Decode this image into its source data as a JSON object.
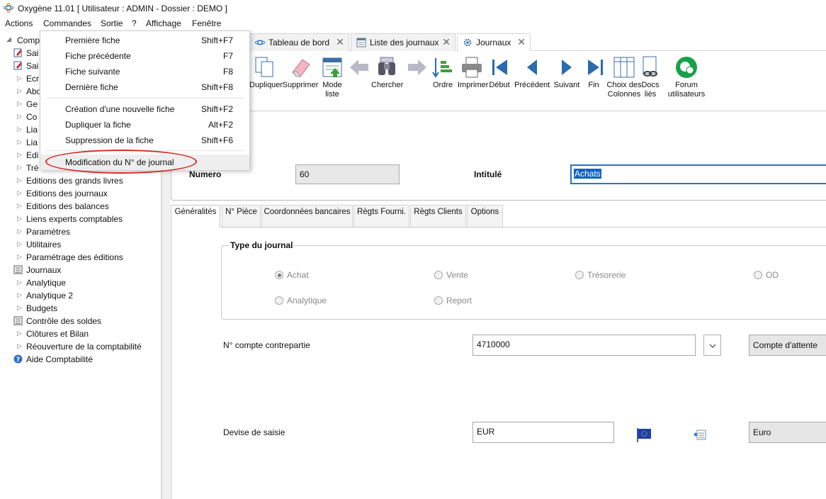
{
  "window": {
    "title": "Oxygène 11.01 [ Utilisateur : ADMIN - Dossier : DEMO ]"
  },
  "menubar": [
    "Actions",
    "Commandes",
    "Sortie",
    "?",
    "Affichage",
    "Fenêtre"
  ],
  "tree": {
    "items": [
      {
        "label": "Comp",
        "kind": "root"
      },
      {
        "label": "Sai",
        "kind": "icon"
      },
      {
        "label": "Sai",
        "kind": "icon"
      },
      {
        "label": "Ecr",
        "kind": "folder"
      },
      {
        "label": "Abo",
        "kind": "folder"
      },
      {
        "label": "Ge",
        "kind": "folder"
      },
      {
        "label": "Co",
        "kind": "folder"
      },
      {
        "label": "Lia",
        "kind": "folder"
      },
      {
        "label": "Lia",
        "kind": "folder"
      },
      {
        "label": "Edi",
        "kind": "folder"
      },
      {
        "label": "Tré",
        "kind": "folder"
      },
      {
        "label": "Editions des grands livres",
        "kind": "folder"
      },
      {
        "label": "Editions des journaux",
        "kind": "folder"
      },
      {
        "label": "Editions des balances",
        "kind": "folder"
      },
      {
        "label": "Liens experts comptables",
        "kind": "folder"
      },
      {
        "label": "Paramètres",
        "kind": "folder"
      },
      {
        "label": "Utilitaires",
        "kind": "folder"
      },
      {
        "label": "Paramétrage des éditions",
        "kind": "folder"
      },
      {
        "label": "Journaux",
        "kind": "journal"
      },
      {
        "label": "Analytique",
        "kind": "folder"
      },
      {
        "label": "Analytique 2",
        "kind": "folder"
      },
      {
        "label": "Budgets",
        "kind": "folder"
      },
      {
        "label": "Contrôle des soldes",
        "kind": "journal"
      },
      {
        "label": "Clôtures et Bilan",
        "kind": "folder"
      },
      {
        "label": "Réouverture de la comptabilité",
        "kind": "folder"
      },
      {
        "label": "Aide Comptabilité",
        "kind": "help"
      }
    ]
  },
  "dropdown": {
    "items": [
      {
        "label": "Première fiche",
        "shortcut": "Shift+F7"
      },
      {
        "label": "Fiche précédente",
        "shortcut": "F7"
      },
      {
        "label": "Fiche suivante",
        "shortcut": "F8"
      },
      {
        "label": "Dernière fiche",
        "shortcut": "Shift+F8"
      },
      {
        "label": "Création d'une nouvelle fiche",
        "shortcut": "Shift+F2"
      },
      {
        "label": "Dupliquer la fiche",
        "shortcut": "Alt+F2"
      },
      {
        "label": "Suppression de la fiche",
        "shortcut": "Shift+F6"
      },
      {
        "label": "Modification du N° de journal",
        "shortcut": ""
      }
    ]
  },
  "tabs": [
    {
      "label": "Tableau de bord"
    },
    {
      "label": "Liste des journaux"
    },
    {
      "label": "Journaux"
    }
  ],
  "toolbar": [
    {
      "label": "Dupliquer",
      "icon": "duplicate-icon"
    },
    {
      "label": "Supprimer",
      "icon": "eraser-icon"
    },
    {
      "label": "Mode liste",
      "icon": "list-mode-icon"
    },
    {
      "label": "",
      "icon": "back-arrow-icon"
    },
    {
      "label": "Chercher",
      "icon": "binoculars-icon"
    },
    {
      "label": "",
      "icon": "forward-arrow-icon"
    },
    {
      "label": "Ordre",
      "icon": "sort-icon"
    },
    {
      "label": "Imprimer",
      "icon": "printer-icon"
    },
    {
      "label": "Début",
      "icon": "first-icon"
    },
    {
      "label": "Précédent",
      "icon": "previous-icon"
    },
    {
      "label": "Suivant",
      "icon": "next-icon"
    },
    {
      "label": "Fin",
      "icon": "last-icon"
    },
    {
      "label": "Choix des Colonnes",
      "icon": "columns-icon"
    },
    {
      "label": "Docs liés",
      "icon": "linked-docs-icon"
    },
    {
      "label": "Forum utilisateurs",
      "icon": "forum-icon"
    }
  ],
  "form": {
    "numero_label": "Numero",
    "numero_value": "60",
    "intitule_label": "Intitulé",
    "intitule_value": "Achats",
    "subtabs": [
      "Généralités",
      "N° Pièce",
      "Coordonnées bancaires",
      "Règts Fourni.",
      "Règts Clients",
      "Options"
    ],
    "type_group_label": "Type du journal",
    "types": [
      {
        "label": "Achat",
        "selected": true
      },
      {
        "label": "Vente",
        "selected": false
      },
      {
        "label": "Trésorerie",
        "selected": false
      },
      {
        "label": "OD",
        "selected": false
      },
      {
        "label": "Analytique",
        "selected": false
      },
      {
        "label": "Report",
        "selected": false
      }
    ],
    "compte_label": "N° compte contrepartie",
    "compte_value": "4710000",
    "compte_name": "Compte d'attente",
    "devise_label": "Devise de saisie",
    "devise_value": "EUR",
    "devise_name": "Euro"
  },
  "colors": {
    "accent": "#1a5fb4",
    "selection": "#0a64c8",
    "annotation": "#d92c2c"
  }
}
